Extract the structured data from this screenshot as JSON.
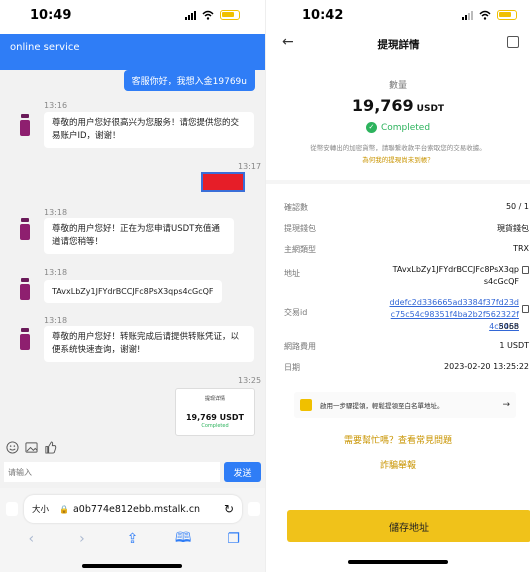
{
  "left_phone": {
    "status_time": "10:49",
    "header_title": "online service",
    "chat": {
      "user_msg_1": "客服你好，我想入金19769u",
      "ts1": "13:16",
      "agent_msg_1": "尊敬的用户您好很高兴为您服务！请您提供您的交易账户ID，谢谢！",
      "ts2": "13:17",
      "ts3": "13:18",
      "agent_msg_2": "尊敬的用户您好！正在为您申请USDT充值通道请您稍等！",
      "ts4": "13:18",
      "agent_msg_3": "TAvxLbZy1JFYdrBCCJFc8PsX3qps4cGcQF",
      "ts5": "13:18",
      "agent_msg_4": "尊敬的用户您好！转账完成后请提供转账凭证，以便系统快速查询，谢谢!",
      "ts6": "13:25",
      "thumb_title": "提现详情",
      "thumb_amount": "19,769 USDT",
      "thumb_status": "Completed"
    },
    "input_placeholder": "请输入",
    "send_label": "发送",
    "browser": {
      "text_size": "大小",
      "url": "a0b774e812ebb.mstalk.cn"
    }
  },
  "right_phone": {
    "status_time": "10:42",
    "title": "提現詳情",
    "qty_label": "數量",
    "amount": "19,769",
    "currency": "USDT",
    "status": "Completed",
    "note": "從幣安轉出的加密貨幣，請聯繫收款平台索取您的交易收據。",
    "why_link": "為何我的提現尚未到帳？",
    "rows": {
      "confirm_k": "確認數",
      "confirm_v": "50 / 1",
      "wallet_k": "提現錢包",
      "wallet_v": "現貨錢包",
      "network_k": "主網類型",
      "network_v": "TRX",
      "address_k": "地址",
      "address_v": "TAvxLbZy1JFYdrBCCJFc8PsX3qps4cGcQF",
      "txid_k": "交易id",
      "txid_v1": "ddefc2d336665ad3384f37fd23dc75c54c98351f4ba2b2f562322f4c845b",
      "txid_v2": "5068",
      "fee_k": "網路費用",
      "fee_v": "1 USDT",
      "date_k": "日期",
      "date_v": "2023-02-20 13:25:22"
    },
    "promo_text": "啟用一步驟提領，輕鬆提領至白名單地址。",
    "help_link": "需要幫忙嗎？查看常見問題",
    "fraud_link": "詐騙舉報",
    "save_label": "儲存地址"
  },
  "colors": {
    "accent_blue": "#2f7df6",
    "binance_yellow": "#f0c21a",
    "success_green": "#2db35d",
    "link_gold": "#c99400",
    "redact_red": "#e61e28"
  }
}
